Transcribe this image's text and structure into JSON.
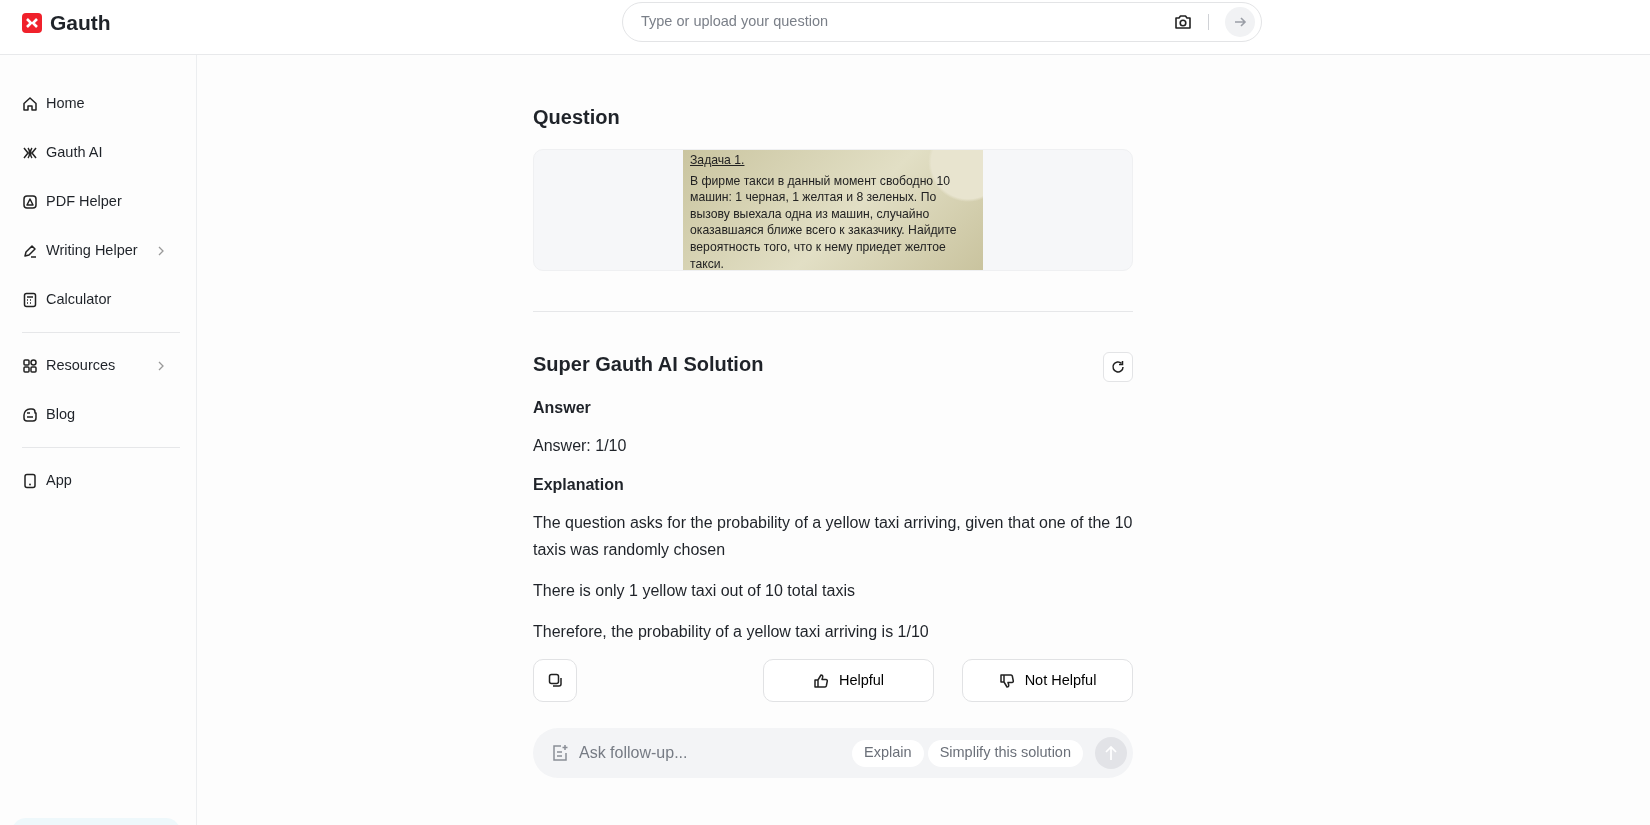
{
  "header": {
    "logo": "Gauth",
    "search": {
      "placeholder": "Type or upload your question"
    }
  },
  "sidebar": {
    "groups": [
      {
        "items": [
          {
            "label": "Home",
            "has_submenu": false
          },
          {
            "label": "Gauth AI",
            "has_submenu": false
          },
          {
            "label": "PDF Helper",
            "has_submenu": false
          },
          {
            "label": "Writing Helper",
            "has_submenu": true
          },
          {
            "label": "Calculator",
            "has_submenu": false
          }
        ]
      },
      {
        "items": [
          {
            "label": "Resources",
            "has_submenu": true
          },
          {
            "label": "Blog",
            "has_submenu": false
          }
        ]
      },
      {
        "items": [
          {
            "label": "App",
            "has_submenu": false
          }
        ]
      }
    ]
  },
  "question": {
    "heading": "Question",
    "document": {
      "title": "Задача 1.",
      "lines": [
        "В фирме такси в данный момент свободно 10",
        "машин: 1 черная, 1 желтая и 8 зеленых. По",
        "вызову выехала одна из машин, случайно",
        "оказавшаяся ближе всего к заказчику. Найдите",
        "вероятность того, что к нему приедет желтое",
        "такси."
      ]
    }
  },
  "solution": {
    "heading": "Super Gauth AI Solution",
    "sections": [
      {
        "title": "Answer",
        "paragraphs": [
          "Answer: 1/10"
        ]
      },
      {
        "title": "Explanation",
        "paragraphs": [
          "The question asks for the probability of a yellow taxi arriving, given that one of the 10 taxis was randomly chosen",
          "There is only 1 yellow taxi out of 10 total taxis",
          "Therefore, the probability of a yellow taxi arriving is 1/10"
        ]
      }
    ],
    "feedback": [
      "Helpful",
      "Not Helpful"
    ]
  },
  "follow_up": {
    "placeholder": "Ask follow-up...",
    "chips": [
      "Explain",
      "Simplify this solution"
    ]
  }
}
